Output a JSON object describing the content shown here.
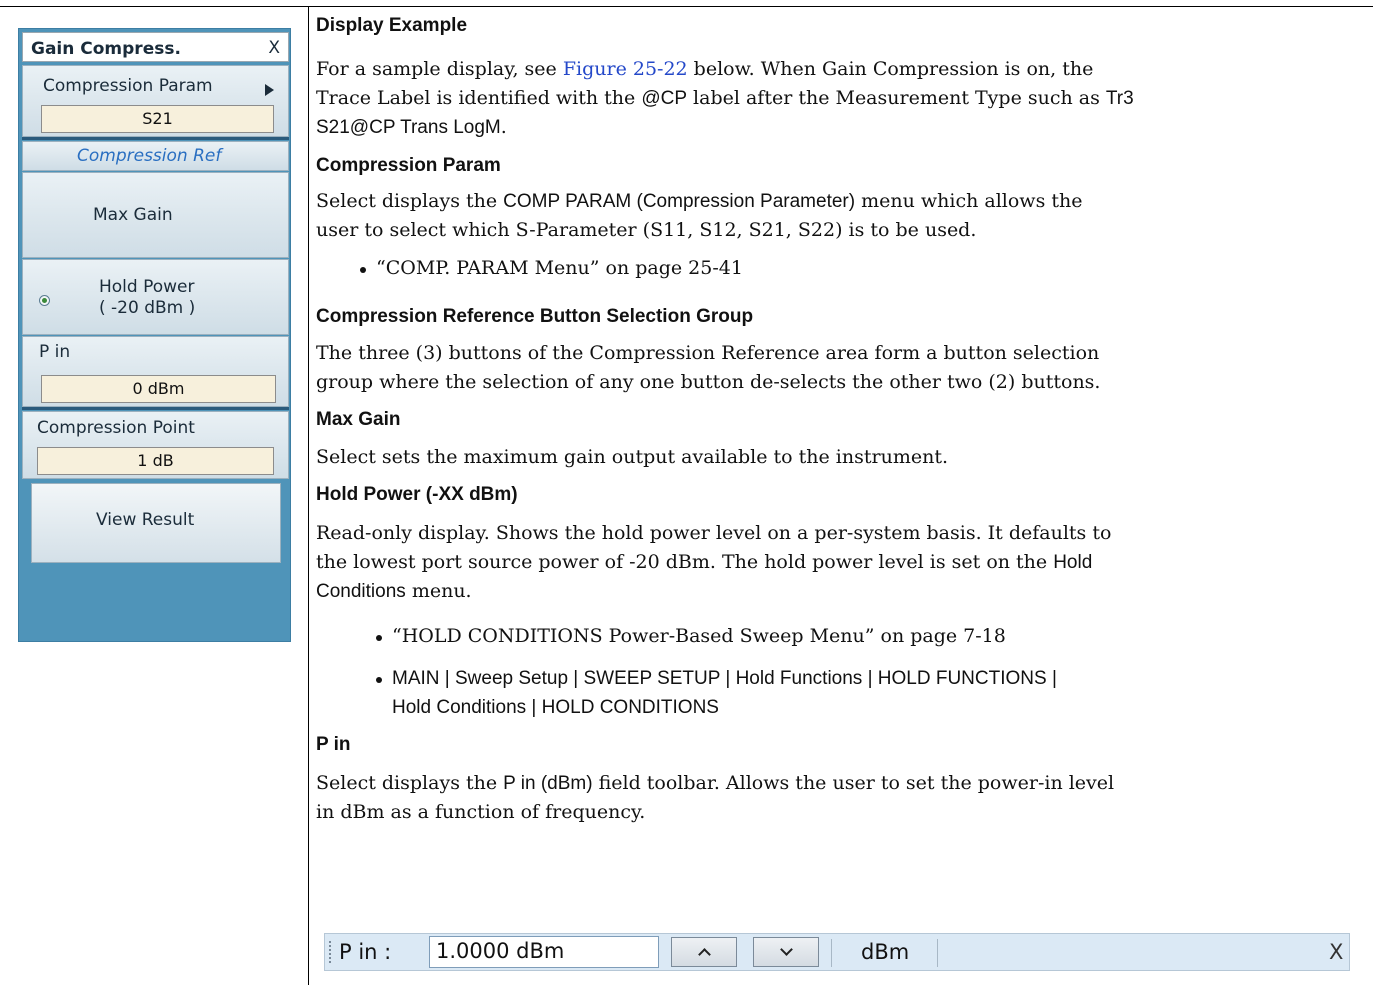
{
  "panel": {
    "title": "Gain Compress.",
    "close_label": "X",
    "compression_param_label": "Compression Param",
    "compression_param_value": "S21",
    "compression_ref_label": "Compression Ref",
    "max_gain_label": "Max Gain",
    "hold_power_label_line1": "Hold Power",
    "hold_power_label_line2": "( -20 dBm )",
    "pin_label": "P in",
    "pin_value": "0  dBm",
    "compression_point_label": "Compression Point",
    "compression_point_value": "1  dB",
    "view_result_label": "View Result"
  },
  "doc": {
    "display_example": {
      "heading": "Display Example",
      "p1_a": "For a sample display, see ",
      "p1_link": "Figure 25-22",
      "p1_b": " below. When Gain Compression is on, the",
      "p2_a": "Trace Label is identified with the ",
      "p2_code": "@CP",
      "p2_b": " label after the Measurement Type such as ",
      "p2_code2": "Tr3",
      "p3_code": "S21@CP Trans LogM",
      "p3_b": "."
    },
    "compression_param": {
      "heading": "Compression Param",
      "p1_a": "Select displays the ",
      "p1_code": "COMP PARAM (Compression Parameter)",
      "p1_b": " menu which allows the",
      "p2": "user to select which S-Parameter (S11, S12, S21, S22) is to be used.",
      "bullet_link": "“COMP. PARAM Menu” on page 25-41"
    },
    "compression_ref": {
      "heading": "Compression Reference Button Selection Group",
      "p1": "The three (3) buttons of the Compression Reference area form a button selection",
      "p2": "group where the selection of any one button de-selects the other two (2) buttons."
    },
    "max_gain": {
      "heading": "Max Gain",
      "p1": "Select sets the maximum gain output available to the instrument."
    },
    "hold_power": {
      "heading": "Hold Power (-XX dBm)",
      "p1": "Read-only display. Shows the hold power level on a per-system basis. It defaults to",
      "p2_a": "the lowest port source power of -20 dBm. The hold power level is set on the ",
      "p2_code": "Hold",
      "p3_code": "Conditions",
      "p3_b": " menu.",
      "bullet1_link": "“HOLD CONDITIONS Power-Based Sweep Menu” on page 7-18",
      "bullet2_line1": "MAIN | Sweep Setup | SWEEP SETUP | Hold Functions | HOLD FUNCTIONS |",
      "bullet2_line2": "Hold Conditions | HOLD CONDITIONS"
    },
    "p_in": {
      "heading": "P in",
      "p1_a": "Select displays the ",
      "p1_code": "P in (dBm)",
      "p1_b": " field toolbar. Allows the user to set the power-in level",
      "p2": "in dBm as a function of frequency."
    }
  },
  "toolbar": {
    "label": "P in  :",
    "value": "1.0000  dBm",
    "unit": "dBm",
    "close": "X"
  }
}
